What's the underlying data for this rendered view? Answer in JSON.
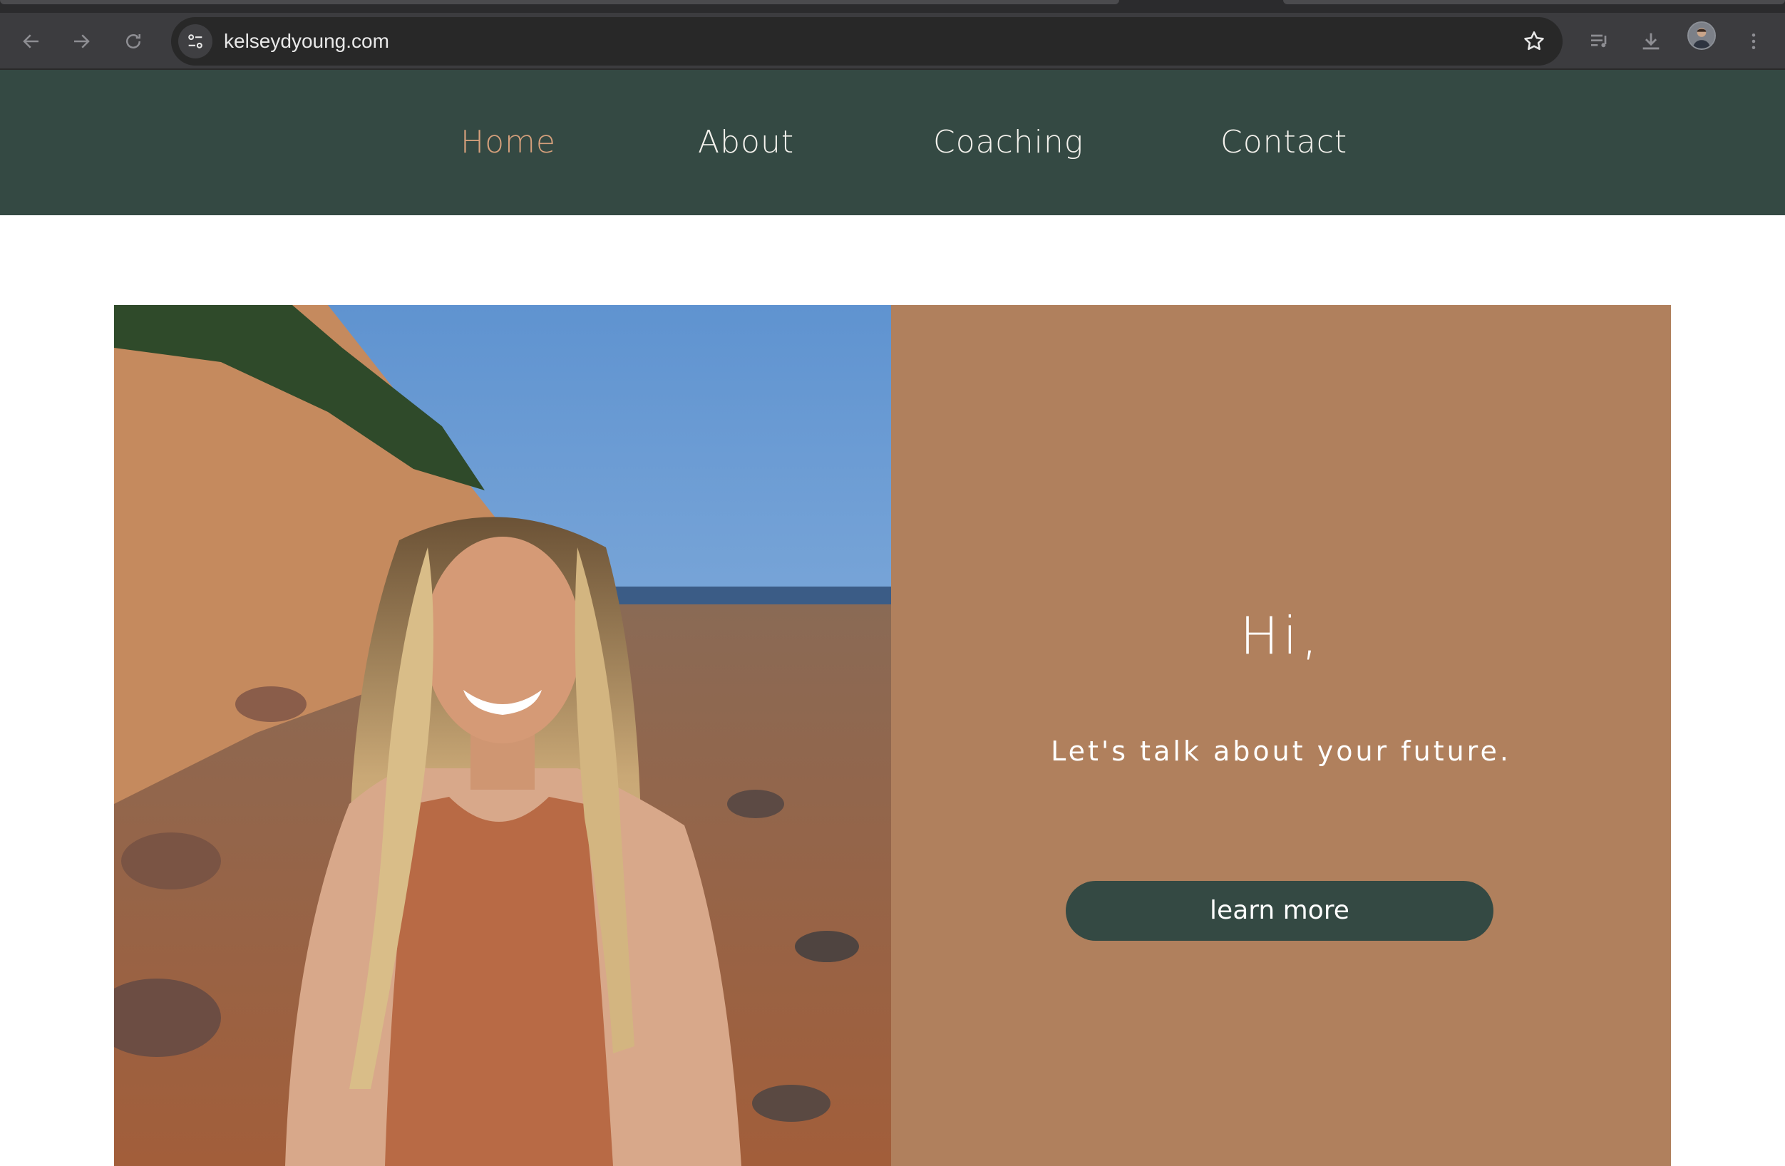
{
  "browser": {
    "url": "kelseydyoung.com",
    "icons": {
      "back": "arrow-left-icon",
      "forward": "arrow-right-icon",
      "reload": "reload-icon",
      "site_info": "tune-icon",
      "bookmark": "star-icon",
      "media": "queue-music-icon",
      "downloads": "download-icon",
      "menu": "kebab-menu-icon"
    }
  },
  "nav": {
    "items": [
      {
        "label": "Home",
        "active": true
      },
      {
        "label": "About",
        "active": false
      },
      {
        "label": "Coaching",
        "active": false
      },
      {
        "label": "Contact",
        "active": false
      }
    ]
  },
  "hero": {
    "greeting": "Hi,",
    "tagline": "Let's talk about your future.",
    "cta_label": "learn more"
  },
  "colors": {
    "header_bg": "#344943",
    "active_link": "#d6a07c",
    "panel_bg": "#b0805d",
    "button_bg": "#344943"
  }
}
